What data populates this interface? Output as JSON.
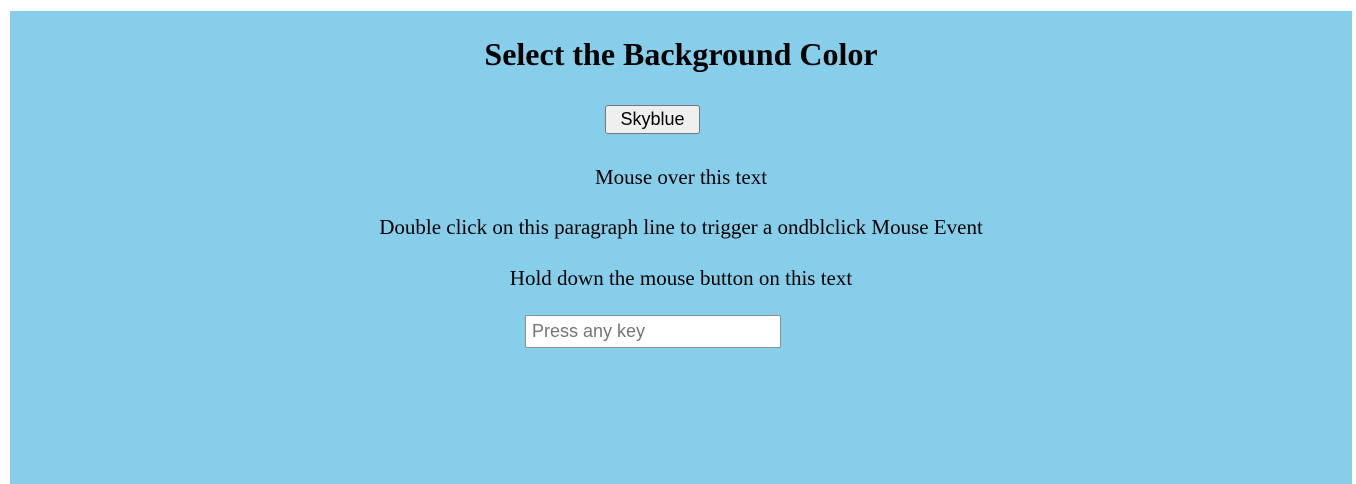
{
  "page": {
    "background_color": "#87ceeb",
    "title": "Select the Background Color"
  },
  "color_button": {
    "label": "Skyblue"
  },
  "paragraphs": {
    "mouseover": "Mouse over this text",
    "dblclick": "Double click on this paragraph line to trigger a ondblclick Mouse Event",
    "mousedown": "Hold down the mouse button on this text"
  },
  "key_input": {
    "value": "",
    "placeholder": "Press any key"
  }
}
